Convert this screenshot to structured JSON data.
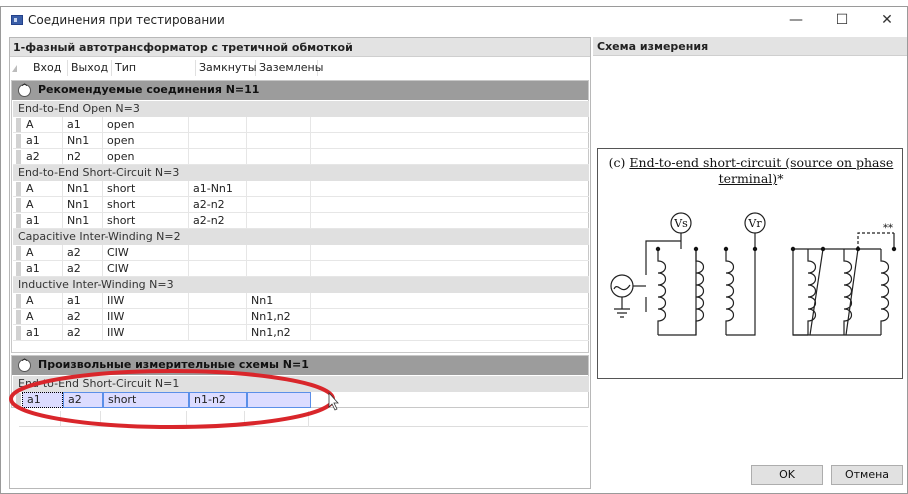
{
  "window": {
    "title": "Соединения при тестировании",
    "minimize": "—",
    "maximize": "☐",
    "close": "✕"
  },
  "left": {
    "header": "1-фазный автотрансформатор с третичной обмоткой",
    "columns": [
      "Вход",
      "Выход",
      "Тип измерения",
      "Замкнуты",
      "Заземлены"
    ]
  },
  "recommended": {
    "title": "Рекомендуемые соединения N=11",
    "icon": "^",
    "groups": [
      {
        "label": "End-to-End Open   N=3",
        "rows": [
          [
            "A",
            "a1",
            "open",
            "",
            ""
          ],
          [
            "a1",
            "Nn1",
            "open",
            "",
            ""
          ],
          [
            "a2",
            "n2",
            "open",
            "",
            ""
          ]
        ]
      },
      {
        "label": "End-to-End Short-Circuit   N=3",
        "rows": [
          [
            "A",
            "Nn1",
            "short",
            "a1-Nn1",
            ""
          ],
          [
            "A",
            "Nn1",
            "short",
            "a2-n2",
            ""
          ],
          [
            "a1",
            "Nn1",
            "short",
            "a2-n2",
            ""
          ]
        ]
      },
      {
        "label": "Capacitive Inter-Winding   N=2",
        "rows": [
          [
            "A",
            "a2",
            "CIW",
            "",
            ""
          ],
          [
            "a1",
            "a2",
            "CIW",
            "",
            ""
          ]
        ]
      },
      {
        "label": "Inductive Inter-Winding   N=3",
        "rows": [
          [
            "A",
            "a1",
            "IIW",
            "",
            "Nn1"
          ],
          [
            "A",
            "a2",
            "IIW",
            "",
            "Nn1,n2"
          ],
          [
            "a1",
            "a2",
            "IIW",
            "",
            "Nn1,n2"
          ]
        ]
      }
    ]
  },
  "custom": {
    "title": "Произвольные измерительные схемы N=1",
    "icon": "^",
    "group_label": "End-to-End Short-Circuit   N=1",
    "row": [
      "a1",
      "a2",
      "short",
      "n1-n2",
      ""
    ]
  },
  "right": {
    "header": "Схема измерения",
    "diagram": {
      "title_prefix": "(c) ",
      "title_underlined": "End-to-end short-circuit (source on phase terminal)",
      "title_suffix": "*",
      "vs_label": "Vs",
      "vr_label": "Vr",
      "double_star": "**"
    }
  },
  "buttons": {
    "ok": "OK",
    "cancel": "Отмена"
  },
  "colors": {
    "annotation": "#d9262b",
    "selection": "#dcdcff",
    "group_header": "#9c9c9c"
  }
}
